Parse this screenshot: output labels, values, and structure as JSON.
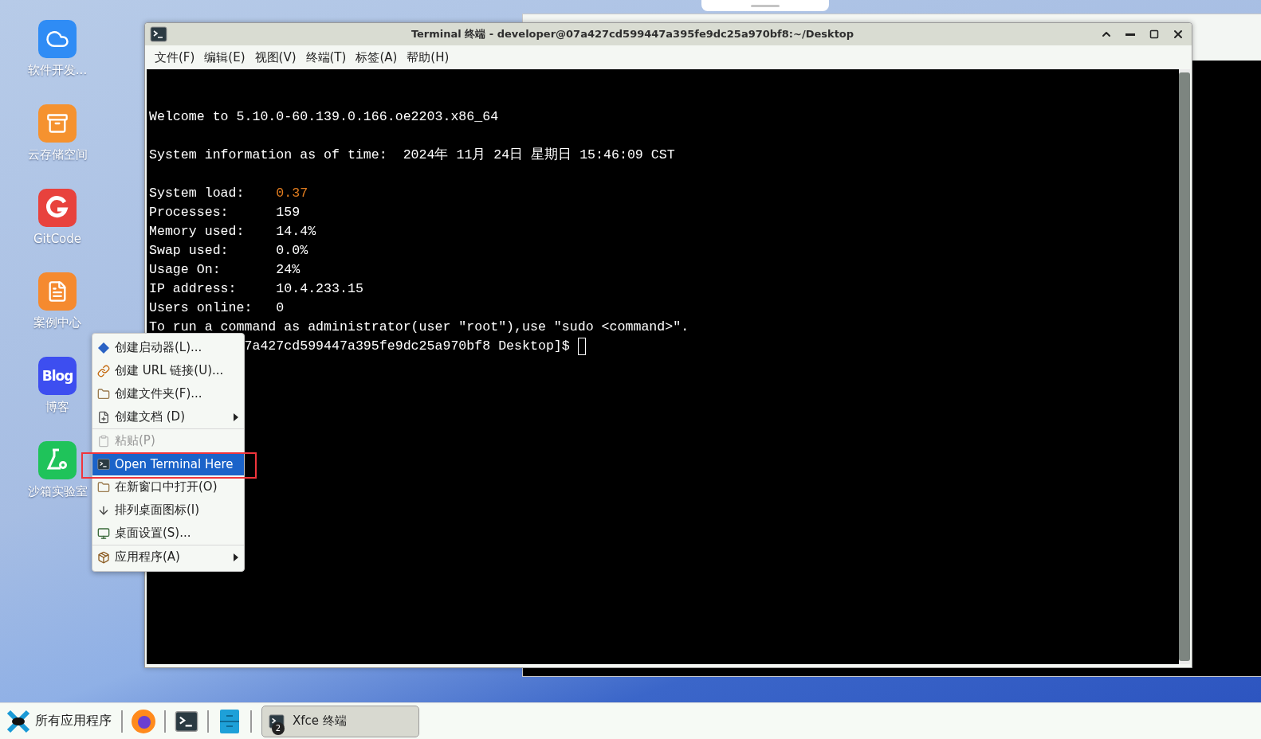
{
  "desktop_icons": [
    {
      "label": "软件开发...",
      "color": "#2f8cf5",
      "kind": "cloud"
    },
    {
      "label": "云存储空间",
      "color": "#f5922f",
      "kind": "storage"
    },
    {
      "label": "GitCode",
      "color": "#e8423d",
      "kind": "gitcode"
    },
    {
      "label": "案例中心",
      "color": "#f58a2f",
      "kind": "cases"
    },
    {
      "label": "博客",
      "color": "#3d4ef0",
      "kind": "blog",
      "glyph": "Blog"
    },
    {
      "label": "沙箱实验室",
      "color": "#1fc35a",
      "kind": "lab"
    }
  ],
  "terminal_window": {
    "title": "Terminal 终端 - developer@07a427cd599447a395fe9dc25a970bf8:~/Desktop",
    "menu": [
      "文件(F)",
      "编辑(E)",
      "视图(V)",
      "终端(T)",
      "标签(A)",
      "帮助(H)"
    ],
    "lines": [
      {
        "kind": "blank"
      },
      {
        "kind": "blank"
      },
      {
        "kind": "text",
        "text": "Welcome to 5.10.0-60.139.0.166.oe2203.x86_64"
      },
      {
        "kind": "blank"
      },
      {
        "kind": "text",
        "text": "System information as of time:  2024年 11月 24日 星期日 15:46:09 CST"
      },
      {
        "kind": "blank"
      },
      {
        "kind": "kv",
        "label": "System load:",
        "value": "0.37",
        "highlighted": true
      },
      {
        "kind": "kv",
        "label": "Processes:",
        "value": "159",
        "highlighted": false
      },
      {
        "kind": "kv",
        "label": "Memory used:",
        "value": "14.4%",
        "highlighted": false
      },
      {
        "kind": "kv",
        "label": "Swap used:",
        "value": "0.0%",
        "highlighted": false
      },
      {
        "kind": "kv",
        "label": "Usage On:",
        "value": "24%",
        "highlighted": false
      },
      {
        "kind": "kv",
        "label": "IP address:",
        "value": "10.4.233.15",
        "highlighted": false
      },
      {
        "kind": "kv",
        "label": "Users online:",
        "value": "0",
        "highlighted": false
      },
      {
        "kind": "text",
        "text": "To run a command as administrator(user \"root\"),use \"sudo <command>\"."
      },
      {
        "kind": "prompt",
        "text": "7a427cd599447a395fe9dc25a970bf8 Desktop]$"
      }
    ]
  },
  "context_menu": {
    "groups": [
      {
        "items": [
          {
            "label": "创建启动器(L)...",
            "kind": "launcher",
            "selected": false,
            "disabled": false,
            "submenu": false
          },
          {
            "label": "创建 URL 链接(U)...",
            "kind": "link",
            "selected": false,
            "disabled": false,
            "submenu": false
          },
          {
            "label": "创建文件夹(F)...",
            "kind": "folder",
            "selected": false,
            "disabled": false,
            "submenu": false
          },
          {
            "label": "创建文档 (D)",
            "kind": "document",
            "selected": false,
            "disabled": false,
            "submenu": true
          }
        ]
      },
      {
        "items": [
          {
            "label": "粘贴(P)",
            "kind": "clipboard",
            "selected": false,
            "disabled": true,
            "submenu": false
          },
          {
            "label": "Open Terminal Here",
            "kind": "terminal",
            "selected": true,
            "disabled": false,
            "submenu": false
          },
          {
            "label": "在新窗口中打开(O)",
            "kind": "folder",
            "selected": false,
            "disabled": false,
            "submenu": false
          },
          {
            "label": "排列桌面图标(I)",
            "kind": "arrange",
            "selected": false,
            "disabled": false,
            "submenu": false
          },
          {
            "label": "桌面设置(S)...",
            "kind": "monitor",
            "selected": false,
            "disabled": false,
            "submenu": false
          }
        ]
      },
      {
        "items": [
          {
            "label": "应用程序(A)",
            "kind": "apps",
            "selected": false,
            "disabled": false,
            "submenu": true
          }
        ]
      }
    ]
  },
  "taskbar": {
    "start_label": "所有应用程序",
    "launchers": [
      {
        "kind": "browser"
      },
      {
        "kind": "terminal"
      },
      {
        "kind": "files"
      }
    ],
    "tasks": [
      {
        "label": "Xfce 终端",
        "count": "2",
        "selected": true
      }
    ]
  }
}
